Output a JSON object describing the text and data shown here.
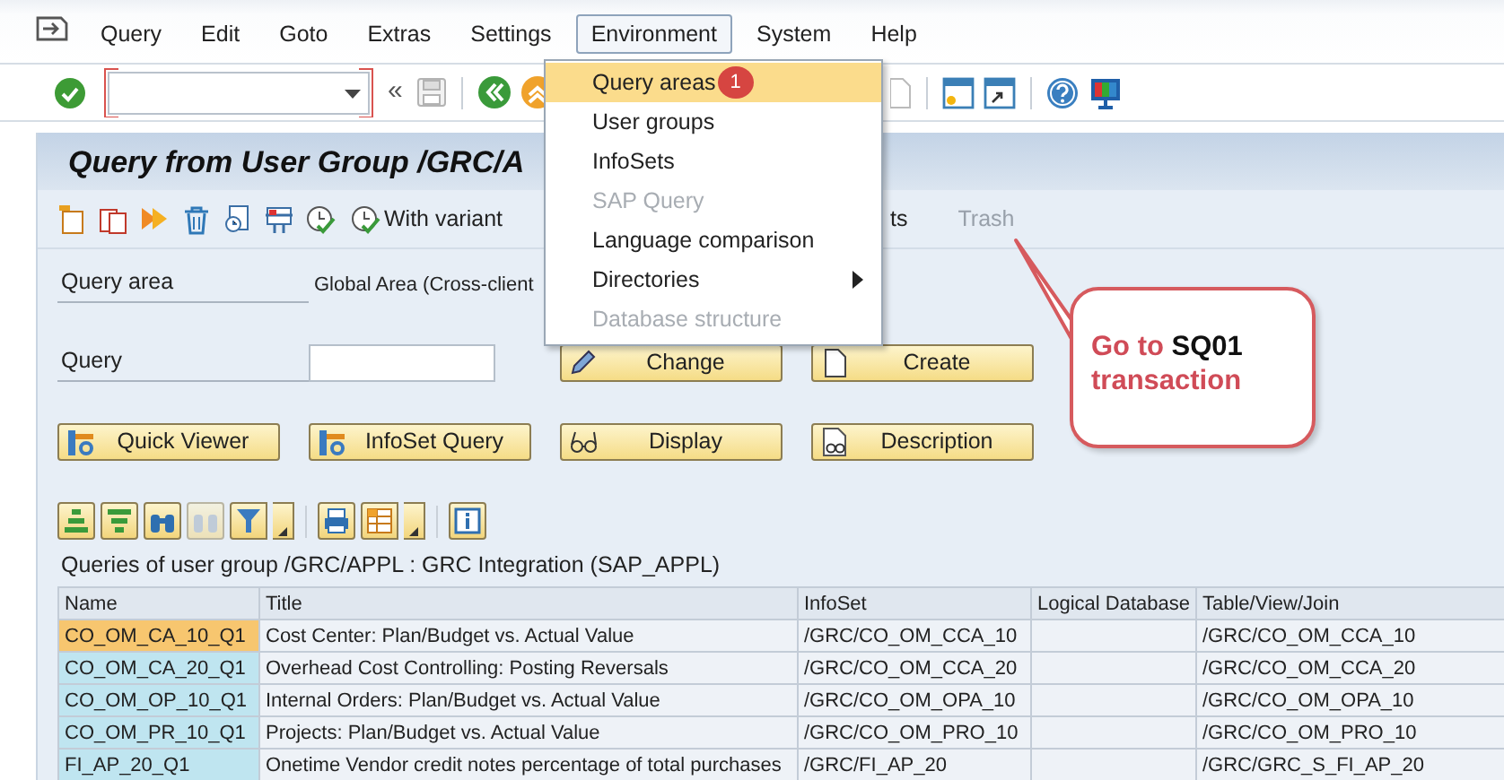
{
  "menubar": {
    "items": [
      {
        "label": "Query",
        "selected": false
      },
      {
        "label": "Edit",
        "selected": false
      },
      {
        "label": "Goto",
        "selected": false
      },
      {
        "label": "Extras",
        "selected": false
      },
      {
        "label": "Settings",
        "selected": false
      },
      {
        "label": "Environment",
        "selected": true
      },
      {
        "label": "System",
        "selected": false
      },
      {
        "label": "Help",
        "selected": false
      }
    ]
  },
  "toolbar": {
    "history_symbol": "«"
  },
  "screen_title": "Query from User Group /GRC/A",
  "app_toolbar": {
    "buttons": [
      {
        "label": "With variant",
        "disabled": false
      },
      {
        "label": "ts",
        "disabled": false
      },
      {
        "label": "Trash",
        "disabled": true
      }
    ]
  },
  "fields": [
    {
      "label": "Query area",
      "kind": "text",
      "value": "Global Area (Cross-client"
    },
    {
      "label": "Query",
      "kind": "input"
    }
  ],
  "query_buttons": [
    {
      "label": "Change"
    },
    {
      "label": "Create"
    }
  ],
  "tool_buttons": [
    {
      "label": "Quick Viewer"
    },
    {
      "label": "InfoSet Query"
    },
    {
      "label": "Display"
    },
    {
      "label": "Description"
    }
  ],
  "table": {
    "caption": "Queries of user group /GRC/APPL : GRC Integration (SAP_APPL)",
    "columns": [
      "Name",
      "Title",
      "InfoSet",
      "Logical Database",
      "Table/View/Join"
    ],
    "rows": [
      {
        "selected": true,
        "name": "CO_OM_CA_10_Q1",
        "title": "Cost Center: Plan/Budget vs. Actual Value",
        "infoset": "/GRC/CO_OM_CCA_10",
        "table_view_join": "/GRC/CO_OM_CCA_10"
      },
      {
        "selected": false,
        "name": "CO_OM_CA_20_Q1",
        "title": "Overhead Cost Controlling: Posting Reversals",
        "infoset": "/GRC/CO_OM_CCA_20",
        "table_view_join": "/GRC/CO_OM_CCA_20"
      },
      {
        "selected": false,
        "name": "CO_OM_OP_10_Q1",
        "title": "Internal Orders: Plan/Budget vs. Actual Value",
        "infoset": "/GRC/CO_OM_OPA_10",
        "table_view_join": "/GRC/CO_OM_OPA_10"
      },
      {
        "selected": false,
        "name": "CO_OM_PR_10_Q1",
        "title": "Projects: Plan/Budget vs. Actual Value",
        "infoset": "/GRC/CO_OM_PRO_10",
        "table_view_join": "/GRC/CO_OM_PRO_10"
      },
      {
        "selected": false,
        "name": "FI_AP_20_Q1",
        "title": "Onetime Vendor credit notes percentage of total purchases",
        "infoset": "/GRC/FI_AP_20",
        "table_view_join": "/GRC/GRC_S_FI_AP_20"
      }
    ]
  },
  "environment_menu": {
    "items": [
      {
        "label": "Query areas",
        "selected": true,
        "disabled": false,
        "submenu": false
      },
      {
        "label": "User groups",
        "selected": false,
        "disabled": false,
        "submenu": false
      },
      {
        "label": "InfoSets",
        "selected": false,
        "disabled": false,
        "submenu": false
      },
      {
        "label": "SAP Query",
        "selected": false,
        "disabled": true,
        "submenu": false
      },
      {
        "label": "Language comparison",
        "selected": false,
        "disabled": false,
        "submenu": false
      },
      {
        "label": "Directories",
        "selected": false,
        "disabled": false,
        "submenu": true
      },
      {
        "label": "Database structure",
        "selected": false,
        "disabled": true,
        "submenu": false
      }
    ]
  },
  "step_badge": "1",
  "callout": {
    "lead": "Go to",
    "code": "SQ01",
    "tail": "transaction"
  }
}
